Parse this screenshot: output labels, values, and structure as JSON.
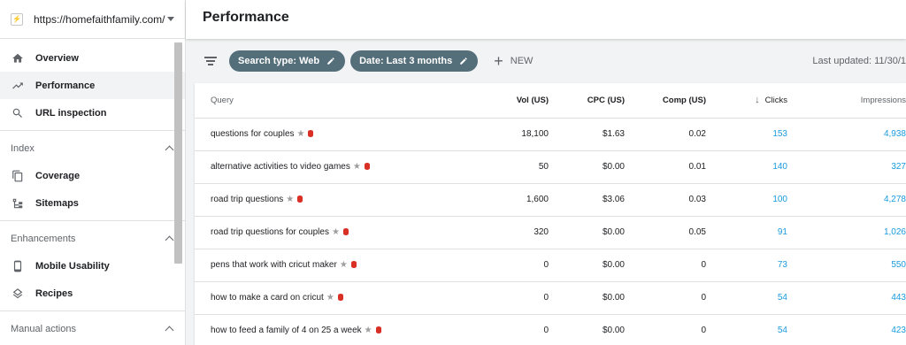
{
  "sidebar": {
    "property_url": "https://homefaithfamily.com/",
    "nav": [
      {
        "label": "Overview",
        "icon": "home-icon"
      },
      {
        "label": "Performance",
        "icon": "trending-up-icon",
        "active": true
      },
      {
        "label": "URL inspection",
        "icon": "search-icon"
      }
    ],
    "sections": [
      {
        "title": "Index",
        "items": [
          {
            "label": "Coverage",
            "icon": "copy-icon"
          },
          {
            "label": "Sitemaps",
            "icon": "sitemap-icon"
          }
        ]
      },
      {
        "title": "Enhancements",
        "items": [
          {
            "label": "Mobile Usability",
            "icon": "phone-icon"
          },
          {
            "label": "Recipes",
            "icon": "layers-icon"
          }
        ]
      },
      {
        "title": "Manual actions",
        "items": []
      }
    ]
  },
  "header": {
    "title": "Performance"
  },
  "filters": {
    "chips": [
      "Search type: Web",
      "Date: Last 3 months"
    ],
    "new_label": "NEW",
    "last_updated": "Last updated: 11/30/1"
  },
  "table": {
    "columns": [
      "Query",
      "Vol (US)",
      "CPC (US)",
      "Comp (US)",
      "Clicks",
      "Impressions"
    ],
    "rows": [
      {
        "query": "questions for couples",
        "vol": "18,100",
        "cpc": "$1.63",
        "comp": "0.02",
        "clicks": "153",
        "impressions": "4,938"
      },
      {
        "query": "alternative activities to video games",
        "vol": "50",
        "cpc": "$0.00",
        "comp": "0.01",
        "clicks": "140",
        "impressions": "327"
      },
      {
        "query": "road trip questions",
        "vol": "1,600",
        "cpc": "$3.06",
        "comp": "0.03",
        "clicks": "100",
        "impressions": "4,278"
      },
      {
        "query": "road trip questions for couples",
        "vol": "320",
        "cpc": "$0.00",
        "comp": "0.05",
        "clicks": "91",
        "impressions": "1,026"
      },
      {
        "query": "pens that work with cricut maker",
        "vol": "0",
        "cpc": "$0.00",
        "comp": "0",
        "clicks": "73",
        "impressions": "550"
      },
      {
        "query": "how to make a card on cricut",
        "vol": "0",
        "cpc": "$0.00",
        "comp": "0",
        "clicks": "54",
        "impressions": "443"
      },
      {
        "query": "how to feed a family of 4 on 25 a week",
        "vol": "0",
        "cpc": "$0.00",
        "comp": "0",
        "clicks": "54",
        "impressions": "423"
      }
    ]
  },
  "colors": {
    "chip": "#546e7a",
    "link": "#1a9bdc",
    "db_icon": "#d93025"
  }
}
